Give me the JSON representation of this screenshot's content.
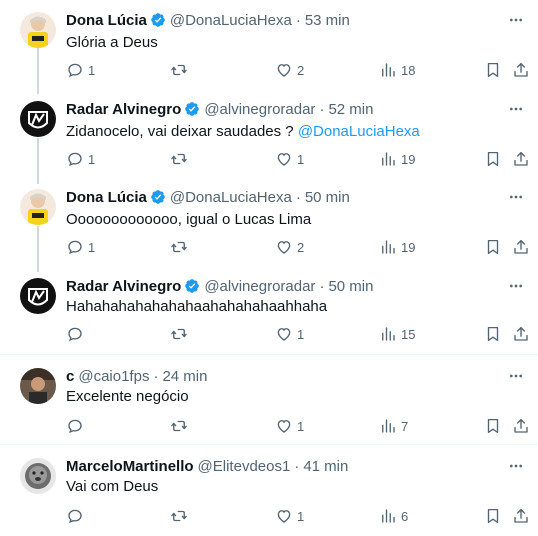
{
  "accent": "#1d9bf0",
  "tweets": [
    {
      "name": "Dona Lúcia",
      "handle": "@DonaLuciaHexa",
      "time": "53 min",
      "text": "Glória a Deus",
      "mention": "",
      "replies": "1",
      "retweets": "",
      "likes": "2",
      "views": "18",
      "avatar": "dona-lucia"
    },
    {
      "name": "Radar Alvinegro",
      "handle": "@alvinegroradar",
      "time": "52 min",
      "text": "Zidanocelo, vai deixar saudades ? ",
      "mention": "@DonaLuciaHexa",
      "replies": "1",
      "retweets": "",
      "likes": "1",
      "views": "19",
      "avatar": "radar"
    },
    {
      "name": "Dona Lúcia",
      "handle": "@DonaLuciaHexa",
      "time": "50 min",
      "text": "Ooooooooooooo, igual o Lucas Lima",
      "mention": "",
      "replies": "1",
      "retweets": "",
      "likes": "2",
      "views": "19",
      "avatar": "dona-lucia"
    },
    {
      "name": "Radar Alvinegro",
      "handle": "@alvinegroradar",
      "time": "50 min",
      "text": "Hahahahahahahahaahahahahaahhaha",
      "mention": "",
      "replies": "",
      "retweets": "",
      "likes": "1",
      "views": "15",
      "avatar": "radar"
    },
    {
      "name": "c",
      "handle": "@caio1fps",
      "time": "24 min",
      "text": "Excelente negócio",
      "mention": "",
      "replies": "",
      "retweets": "",
      "likes": "1",
      "views": "7",
      "avatar": "caio"
    },
    {
      "name": "MarceloMartinello",
      "handle": "@Elitevdeos1",
      "time": "41 min",
      "text": "Vai com Deus",
      "mention": "",
      "replies": "",
      "retweets": "",
      "likes": "1",
      "views": "6",
      "avatar": "marcelo"
    }
  ]
}
